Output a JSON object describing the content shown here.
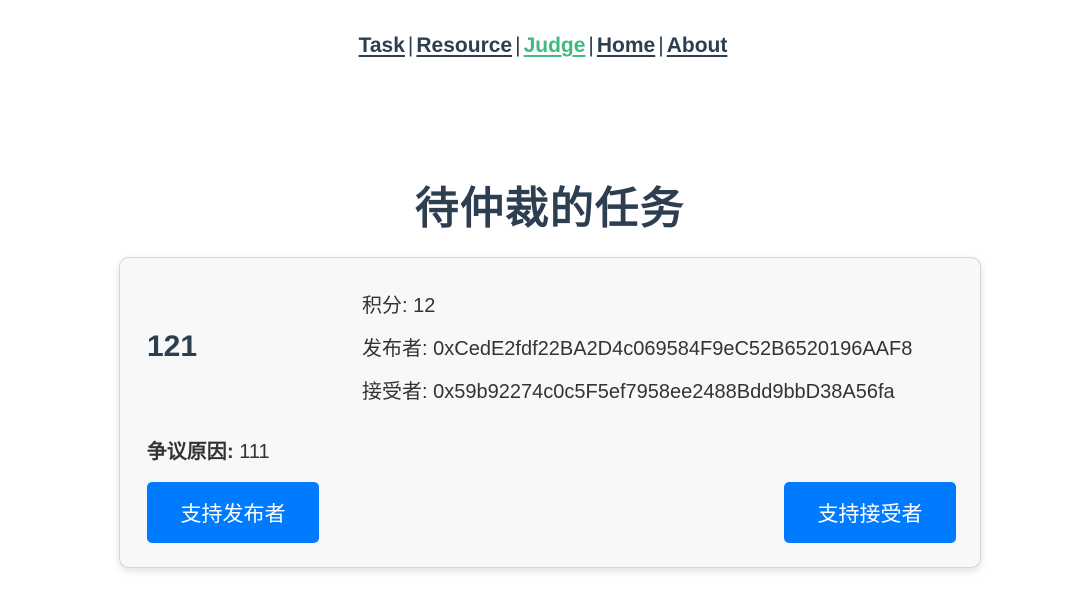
{
  "nav": {
    "items": [
      {
        "label": "Task",
        "active": false
      },
      {
        "label": "Resource",
        "active": false
      },
      {
        "label": "Judge",
        "active": true
      },
      {
        "label": "Home",
        "active": false
      },
      {
        "label": "About",
        "active": false
      }
    ],
    "separator": "|",
    "active_color": "#42b983",
    "text_color": "#2c3e50"
  },
  "page": {
    "title": "待仲裁的任务"
  },
  "task": {
    "id": "121",
    "points_label": "积分:",
    "points_value": "12",
    "publisher_label": "发布者:",
    "publisher_value": "0xCedE2fdf22BA2D4c069584F9eC52B6520196AAF8",
    "receiver_label": "接受者:",
    "receiver_value": "0x59b92274c0c5F5ef7958ee2488Bdd9bbD38A56fa",
    "dispute_label": "争议原因:",
    "dispute_value": "111",
    "support_publisher_label": "支持发布者",
    "support_receiver_label": "支持接受者",
    "button_color": "#007bff"
  }
}
